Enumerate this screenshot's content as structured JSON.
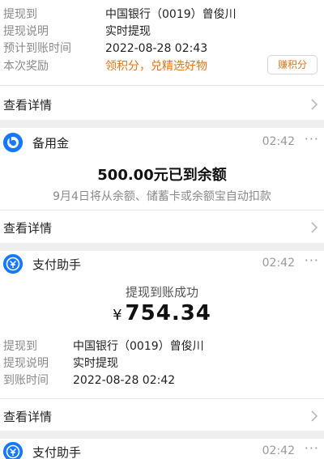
{
  "card1": {
    "rows": [
      {
        "label": "提现到",
        "value": "中国银行（0019）曾俊川"
      },
      {
        "label": "提现说明",
        "value": "实时提现"
      },
      {
        "label": "预计到账时间",
        "value": "2022-08-28 02:43"
      },
      {
        "label": "本次奖励",
        "value": "领积分，兑精选好物"
      }
    ],
    "points_button": "赚积分",
    "detail": "查看详情"
  },
  "card2": {
    "service": "备用金",
    "time": "02:42",
    "more": "···",
    "headline": "500.00元已到余额",
    "subline": "9月4日将从余额、储蓄卡或余额宝自动扣款",
    "detail": "查看详情"
  },
  "card3": {
    "service": "支付助手",
    "time": "02:42",
    "more": "···",
    "status": "提现到账成功",
    "currency": "¥",
    "amount": "754.34",
    "rows": [
      {
        "label": "提现到",
        "value": "中国银行（0019）曾俊川"
      },
      {
        "label": "提现说明",
        "value": "实时提现"
      },
      {
        "label": "到账时间",
        "value": "2022-08-28 02:42"
      }
    ],
    "detail": "查看详情"
  },
  "card4": {
    "service": "支付助手",
    "time": "02:42",
    "more": "···"
  },
  "colors": {
    "accent": "#1677ff",
    "orange": "#e3751a",
    "background": "#efefef"
  }
}
